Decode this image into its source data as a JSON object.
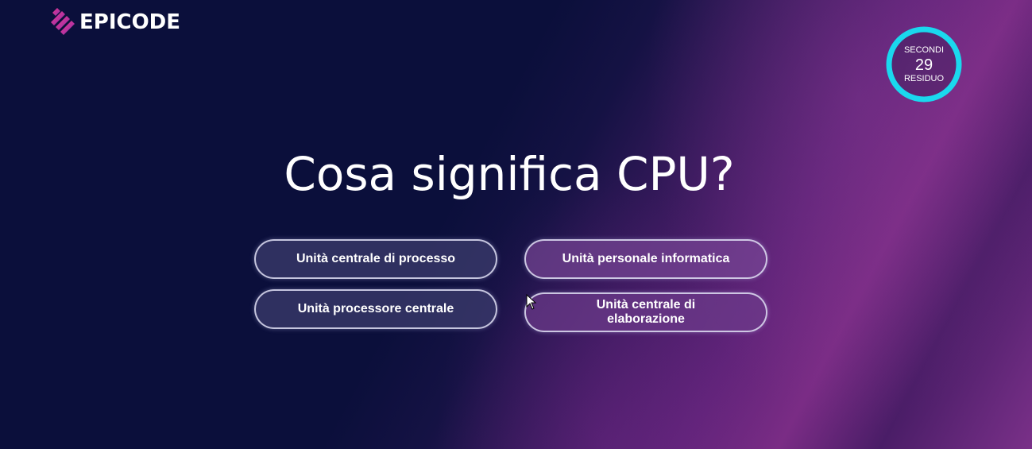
{
  "brand": {
    "name": "EPICODE",
    "logo_icon": "epicode-stripes-icon",
    "accent_color": "#e0308a"
  },
  "timer": {
    "label_top": "SECONDI",
    "value": "29",
    "label_bottom": "RESIDUO",
    "ring_color": "#1ad8ee"
  },
  "question": {
    "text": "Cosa significa CPU?"
  },
  "answers": [
    {
      "label": "Unità centrale di processo"
    },
    {
      "label": "Unità personale informatica"
    },
    {
      "label": "Unità processore centrale"
    },
    {
      "label": "Unità centrale di elaborazione"
    }
  ],
  "colors": {
    "background_start": "#0b0f3b",
    "background_end": "#7a3088"
  }
}
